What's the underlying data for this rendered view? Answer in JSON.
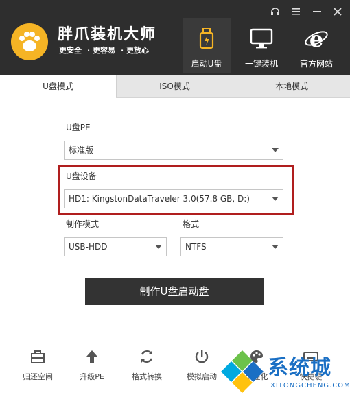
{
  "app": {
    "title": "胖爪装机大师",
    "taglines": [
      "更安全",
      "更容易",
      "更放心"
    ]
  },
  "window_controls": [
    "headset-icon",
    "menu-icon",
    "minimize-icon",
    "close-icon"
  ],
  "nav": [
    {
      "label": "启动U盘",
      "icon": "usb-drive-icon",
      "active": true
    },
    {
      "label": "一键装机",
      "icon": "monitor-icon",
      "active": false
    },
    {
      "label": "官方网站",
      "icon": "ie-browser-icon",
      "active": false
    }
  ],
  "tabs": [
    {
      "label": "U盘模式",
      "active": true
    },
    {
      "label": "ISO模式",
      "active": false
    },
    {
      "label": "本地模式",
      "active": false
    }
  ],
  "form": {
    "pe_label": "U盘PE",
    "pe_value": "标准版",
    "device_label": "U盘设备",
    "device_value": "HD1: KingstonDataTraveler 3.0(57.8 GB, D:)",
    "mode_label": "制作模式",
    "mode_value": "USB-HDD",
    "format_label": "格式",
    "format_value": "NTFS",
    "make_button": "制作U盘启动盘"
  },
  "tools": [
    {
      "label": "归还空间",
      "icon": "restore-space-icon"
    },
    {
      "label": "升级PE",
      "icon": "arrow-up-icon"
    },
    {
      "label": "格式转换",
      "icon": "refresh-icon"
    },
    {
      "label": "模拟启动",
      "icon": "power-icon"
    },
    {
      "label": "个性化",
      "icon": "palette-icon"
    },
    {
      "label": "快捷键",
      "icon": "keyboard-icon"
    }
  ],
  "watermark": {
    "text": "系统城",
    "sub": "XITONGCHENG.COM"
  },
  "colors": {
    "header": "#2e2e2e",
    "logo": "#f5b425",
    "highlight": "#b01e1e",
    "button": "#333333",
    "watermark": "#1a6fc4"
  }
}
